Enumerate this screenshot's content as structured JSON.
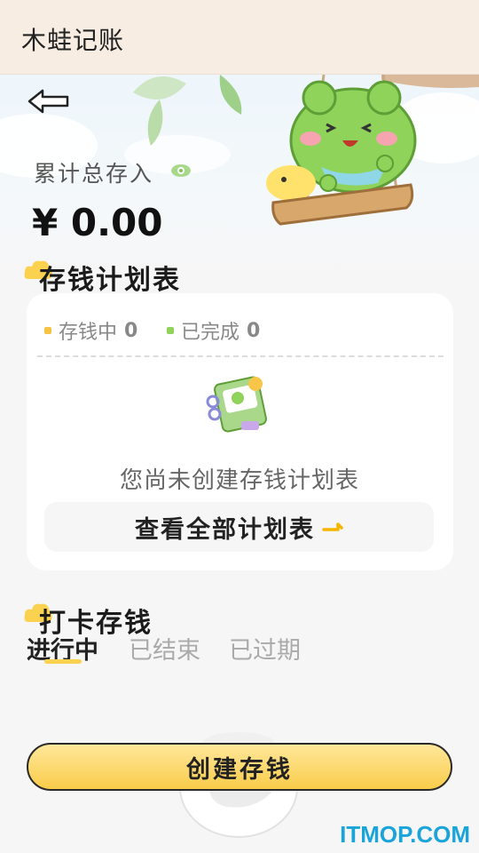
{
  "app": {
    "title": "木蛙记账"
  },
  "summary": {
    "total_label": "累计总存入",
    "currency": "¥",
    "amount": "0.00"
  },
  "plan": {
    "title": "存钱计划表",
    "stats": [
      {
        "label": "存钱中",
        "count": "0",
        "color": "#f6c343"
      },
      {
        "label": "已完成",
        "count": "0",
        "color": "#8fd35b"
      }
    ],
    "empty_text": "您尚未创建存钱计划表",
    "view_all_label": "查看全部计划表"
  },
  "checkin": {
    "title": "打卡存钱",
    "tabs": [
      {
        "label": "进行中",
        "active": true
      },
      {
        "label": "已结束",
        "active": false
      },
      {
        "label": "已过期",
        "active": false
      }
    ]
  },
  "create_button": {
    "label": "创建存钱"
  },
  "watermark": "ITMOP.COM",
  "colors": {
    "accent_yellow": "#f9cc4a",
    "header_bg": "#f7ede2",
    "frog_green": "#8fd35b",
    "watermark_blue": "#1aa4d9"
  },
  "icons": [
    "back-arrow-icon",
    "eye-icon",
    "book-icon",
    "arrow-right-icon",
    "frog-swing-illustration",
    "cloud-icon"
  ]
}
